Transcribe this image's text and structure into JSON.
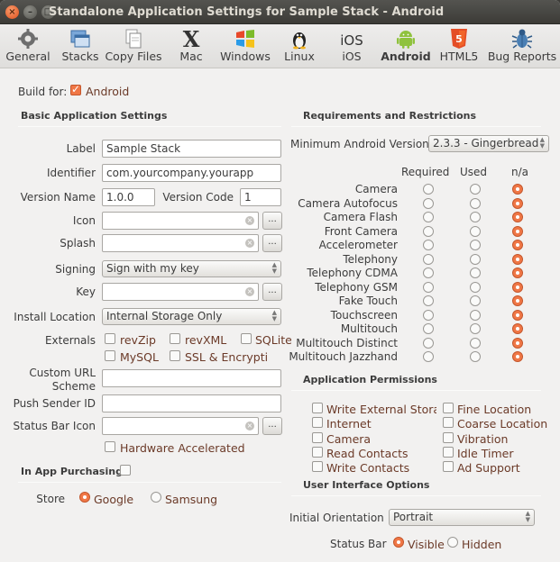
{
  "window": {
    "title": "Standalone Application Settings for Sample Stack - Android"
  },
  "toolbar": {
    "tabs": [
      {
        "label": "General",
        "icon": "gear-icon"
      },
      {
        "label": "Stacks",
        "icon": "windows-stack-icon"
      },
      {
        "label": "Copy Files",
        "icon": "files-icon"
      },
      {
        "label": "Mac",
        "icon": "mac-x-icon"
      },
      {
        "label": "Windows",
        "icon": "windows-logo-icon"
      },
      {
        "label": "Linux",
        "icon": "tux-penguin-icon"
      },
      {
        "label": "iOS",
        "icon": "ios-text-icon"
      },
      {
        "label": "Android",
        "icon": "android-robot-icon"
      },
      {
        "label": "HTML5",
        "icon": "html5-shield-icon"
      },
      {
        "label": "Bug Reports",
        "icon": "bug-icon"
      }
    ],
    "active": "Android"
  },
  "build_for": {
    "label": "Build for:",
    "option": "Android",
    "checked": true
  },
  "basic": {
    "title": "Basic Application Settings",
    "label_label": "Label",
    "label_value": "Sample Stack",
    "identifier_label": "Identifier",
    "identifier_value": "com.yourcompany.yourapp",
    "version_name_label": "Version Name",
    "version_name_value": "1.0.0",
    "version_code_label": "Version Code",
    "version_code_value": "1",
    "icon_label": "Icon",
    "icon_value": "",
    "splash_label": "Splash",
    "splash_value": "",
    "browse_label": "...",
    "signing_label": "Signing",
    "signing_value": "Sign with my key",
    "key_label": "Key",
    "key_value": "",
    "install_location_label": "Install Location",
    "install_location_value": "Internal Storage Only",
    "externals_label": "Externals",
    "externals": [
      {
        "label": "revZip",
        "checked": false
      },
      {
        "label": "revXML",
        "checked": false
      },
      {
        "label": "SQLite",
        "checked": false
      },
      {
        "label": "MySQL",
        "checked": false
      },
      {
        "label": "SSL & Encryption",
        "checked": false
      }
    ],
    "custom_url_label_1": "Custom URL",
    "custom_url_label_2": "Scheme",
    "custom_url_value": "",
    "push_sender_label": "Push Sender ID",
    "push_sender_value": "",
    "status_bar_icon_label": "Status Bar Icon",
    "status_bar_icon_value": "",
    "hardware_accelerated_label": "Hardware Accelerated",
    "hardware_accelerated_checked": false
  },
  "in_app": {
    "title": "In App Purchasing",
    "checked": false,
    "store_label": "Store",
    "stores": [
      {
        "label": "Google",
        "selected": true
      },
      {
        "label": "Samsung",
        "selected": false
      }
    ]
  },
  "requirements": {
    "title": "Requirements and Restrictions",
    "min_version_label": "Minimum Android Version",
    "min_version_value": "2.3.3 - Gingerbread",
    "col_required": "Required",
    "col_used": "Used",
    "col_na": "n/a",
    "features": [
      {
        "label": "Camera",
        "value": "n/a"
      },
      {
        "label": "Camera Autofocus",
        "value": "n/a"
      },
      {
        "label": "Camera Flash",
        "value": "n/a"
      },
      {
        "label": "Front Camera",
        "value": "n/a"
      },
      {
        "label": "Accelerometer",
        "value": "n/a"
      },
      {
        "label": "Telephony",
        "value": "n/a"
      },
      {
        "label": "Telephony CDMA",
        "value": "n/a"
      },
      {
        "label": "Telephony GSM",
        "value": "n/a"
      },
      {
        "label": "Fake Touch",
        "value": "n/a"
      },
      {
        "label": "Touchscreen",
        "value": "n/a"
      },
      {
        "label": "Multitouch",
        "value": "n/a"
      },
      {
        "label": "Multitouch Distinct",
        "value": "n/a"
      },
      {
        "label": "Multitouch Jazzhand",
        "value": "n/a"
      }
    ]
  },
  "permissions": {
    "title": "Application Permissions",
    "left": [
      {
        "label": "Write External Storage",
        "checked": false
      },
      {
        "label": "Internet",
        "checked": false
      },
      {
        "label": "Camera",
        "checked": false
      },
      {
        "label": "Read Contacts",
        "checked": false
      },
      {
        "label": "Write Contacts",
        "checked": false
      }
    ],
    "right": [
      {
        "label": "Fine Location",
        "checked": false
      },
      {
        "label": "Coarse Location",
        "checked": false
      },
      {
        "label": "Vibration",
        "checked": false
      },
      {
        "label": "Idle Timer",
        "checked": false
      },
      {
        "label": "Ad Support",
        "checked": false
      }
    ]
  },
  "ui_options": {
    "title": "User Interface Options",
    "orientation_label": "Initial Orientation",
    "orientation_value": "Portrait",
    "status_bar_label": "Status Bar",
    "status_bar_options": [
      {
        "label": "Visible",
        "selected": true
      },
      {
        "label": "Hidden",
        "selected": false
      }
    ]
  },
  "colors": {
    "accent": "#f07746",
    "titlebar": "#3c3b37",
    "window_bg": "#f2f1f0",
    "checkbox_label": "#6b3a28"
  }
}
